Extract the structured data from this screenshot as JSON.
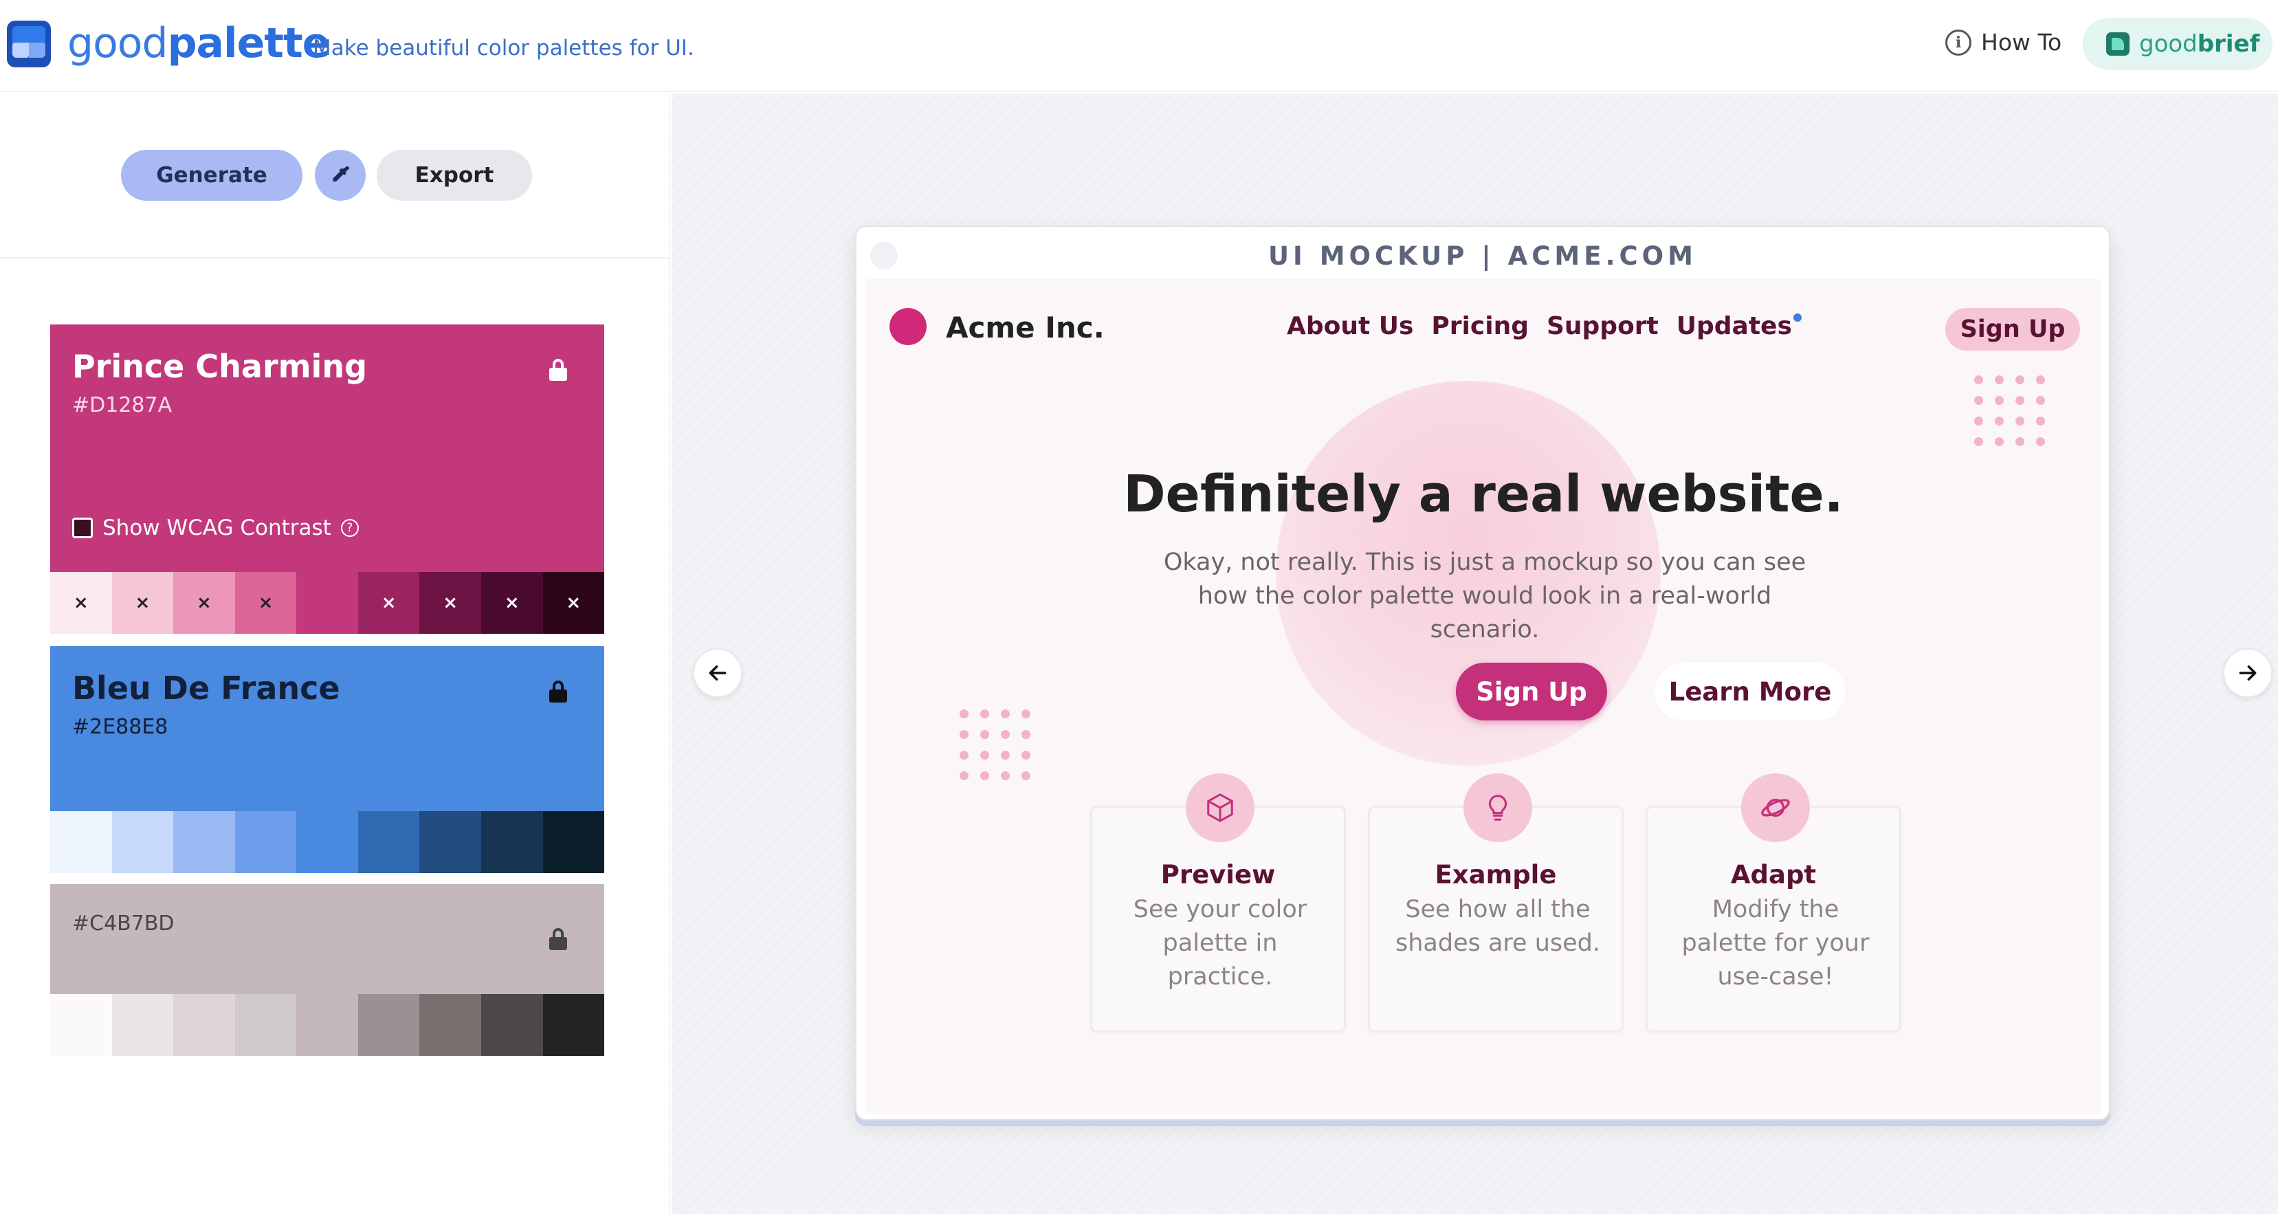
{
  "header": {
    "brand_light": "good",
    "brand_bold": "palette",
    "tagline": "Make beautiful color palettes for UI.",
    "howto_label": "How To",
    "goodbrief_light": "good",
    "goodbrief_bold": "brief"
  },
  "toolbar": {
    "generate_label": "Generate",
    "export_label": "Export"
  },
  "palette": {
    "primary": {
      "name": "Prince Charming",
      "hex": "#D1287A",
      "base_color": "#C2387B",
      "wcag_label": "Show WCAG Contrast",
      "shades": [
        "#fbe9f0",
        "#f5c6d6",
        "#ec97b9",
        "#dd6598",
        "#c2387b",
        "#9a2460",
        "#6e1445",
        "#4a0a2e",
        "#2d0519"
      ],
      "shade_marks": [
        "×",
        "×",
        "×",
        "×",
        "",
        "×",
        "×",
        "×",
        "×"
      ]
    },
    "secondary": {
      "name": "Bleu De France",
      "hex": "#2E88E8",
      "base_color": "#4A89E0",
      "shades": [
        "#eef5fe",
        "#c6d9fb",
        "#9bbaf4",
        "#6e9dec",
        "#4a89e0",
        "#2f6ab3",
        "#204c7f",
        "#173452",
        "#0a1e2a"
      ]
    },
    "neutral": {
      "hex": "#C4B7BD",
      "base_color": "#C4B7BD",
      "shades": [
        "#fbf9fa",
        "#e9e5e6",
        "#ddd5d8",
        "#d0c9cb",
        "#c4b7bd",
        "#9b9095",
        "#77706f",
        "#4d484a",
        "#242324"
      ]
    }
  },
  "mockup": {
    "title": "UI MOCKUP | ACME.COM",
    "brand": "Acme Inc.",
    "nav": [
      "About Us",
      "Pricing",
      "Support",
      "Updates"
    ],
    "signup_top": "Sign Up",
    "hero_title": "Definitely a real website.",
    "hero_sub": "Okay, not really. This is just a mockup so you can see how the color palette would look in a real-world scenario.",
    "cta_signup": "Sign Up",
    "cta_learn": "Learn More",
    "cards": [
      {
        "icon": "cube-icon",
        "title": "Preview",
        "text": "See your color palette in practice."
      },
      {
        "icon": "lightbulb-icon",
        "title": "Example",
        "text": "See how all the shades are used."
      },
      {
        "icon": "planet-icon",
        "title": "Adapt",
        "text": "Modify the palette for your use-case!"
      }
    ]
  }
}
